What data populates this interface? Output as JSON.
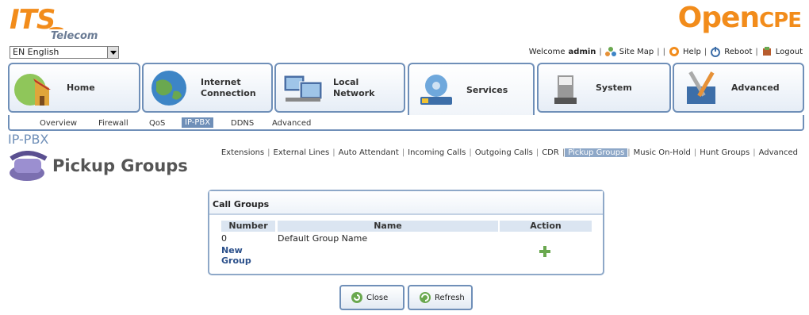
{
  "brand": {
    "its": "ITS",
    "telecom": "Telecom",
    "open": "Open",
    "cpe": "CPE"
  },
  "language": {
    "selected": "EN English"
  },
  "toplinks": {
    "welcome": "Welcome",
    "user": "admin",
    "sitemap": "Site Map",
    "help": "Help",
    "reboot": "Reboot",
    "logout": "Logout"
  },
  "tabs": [
    {
      "label": "Home"
    },
    {
      "label": "Internet\nConnection"
    },
    {
      "label": "Local\nNetwork"
    },
    {
      "label": "Services"
    },
    {
      "label": "System"
    },
    {
      "label": "Advanced"
    }
  ],
  "subtabs": [
    {
      "label": "Overview"
    },
    {
      "label": "Firewall"
    },
    {
      "label": "QoS"
    },
    {
      "label": "IP-PBX"
    },
    {
      "label": "DDNS"
    },
    {
      "label": "Advanced"
    }
  ],
  "section": "IP-PBX",
  "rnav": [
    {
      "label": "Extensions"
    },
    {
      "label": "External Lines"
    },
    {
      "label": "Auto Attendant"
    },
    {
      "label": "Incoming Calls"
    },
    {
      "label": "Outgoing Calls"
    },
    {
      "label": "CDR"
    },
    {
      "label": "Pickup Groups"
    },
    {
      "label": "Music On-Hold"
    },
    {
      "label": "Hunt Groups"
    },
    {
      "label": "Advanced"
    }
  ],
  "page_title": "Pickup Groups",
  "panel": {
    "title": "Call Groups",
    "columns": [
      "Number",
      "Name",
      "Action"
    ],
    "rows": [
      {
        "number": "0",
        "name": "Default Group Name"
      }
    ],
    "new_group_line1": "New",
    "new_group_line2": "Group"
  },
  "buttons": {
    "close": "Close",
    "refresh": "Refresh"
  },
  "colors": {
    "accent": "#6f8fb8",
    "orange": "#f28c1b"
  }
}
